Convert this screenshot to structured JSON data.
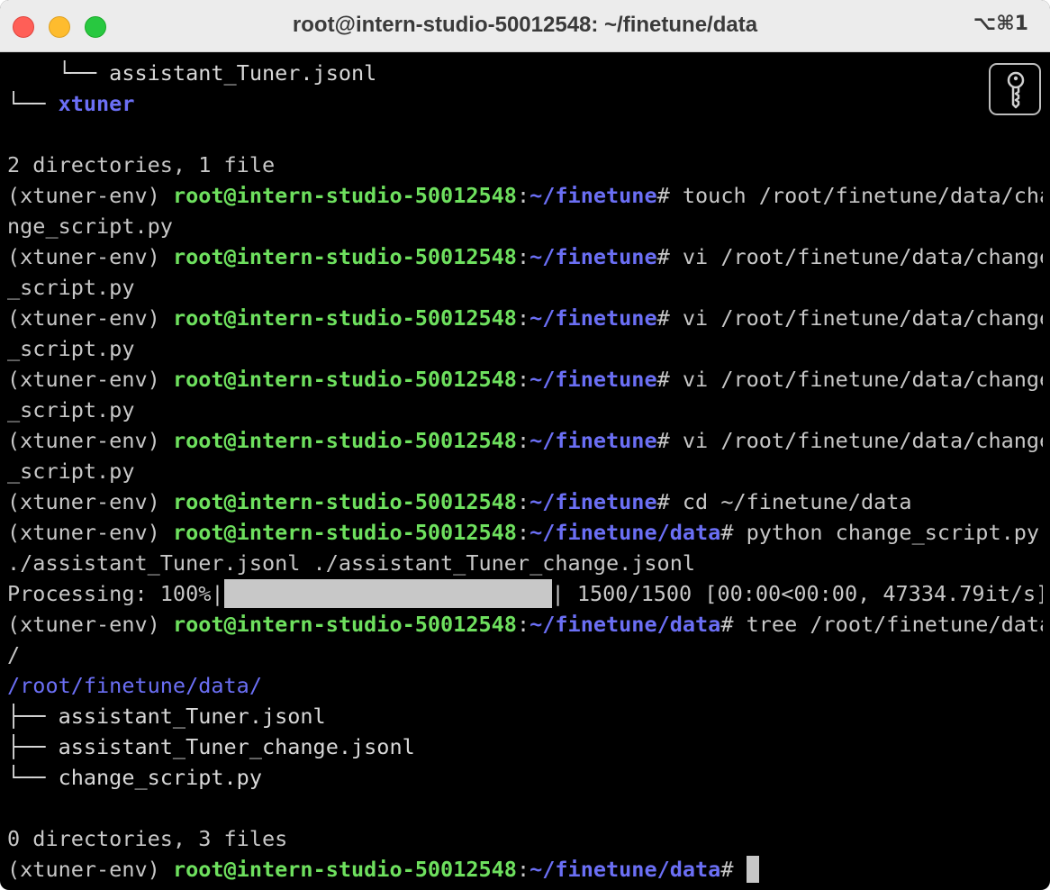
{
  "window": {
    "title": "root@intern-studio-50012548: ~/finetune/data",
    "shortcut": "⌥⌘1"
  },
  "terminal": {
    "env": "(xtuner-env) ",
    "user_host": "root@intern-studio-50012548",
    "colon": ":",
    "path_finetune": "~/finetune",
    "path_data": "~/finetune/data",
    "hash": "# ",
    "tree_top": {
      "file_line": "    └── assistant_Tuner.jsonl",
      "dir_branch": "└── ",
      "dir_name": "xtuner",
      "summary": "2 directories, 1 file"
    },
    "commands": [
      {
        "cmd": "touch /root/finetune/data/cha",
        "wrap": "nge_script.py"
      },
      {
        "cmd": "vi /root/finetune/data/change",
        "wrap": "_script.py"
      },
      {
        "cmd": "vi /root/finetune/data/change",
        "wrap": "_script.py"
      },
      {
        "cmd": "vi /root/finetune/data/change",
        "wrap": "_script.py"
      },
      {
        "cmd": "vi /root/finetune/data/change",
        "wrap": "_script.py"
      },
      {
        "cmd": "cd ~/finetune/data"
      },
      {
        "cmd": "python change_script.py",
        "wrap": "./assistant_Tuner.jsonl ./assistant_Tuner_change.jsonl"
      },
      {
        "cmd": "tree /root/finetune/data",
        "wrap": "/"
      }
    ],
    "progress": {
      "label": "Processing: 100%|",
      "percent": 100,
      "stats": "| 1500/1500 [00:00<00:00, 47334.79it/s]"
    },
    "tree_result": {
      "root": "/root/finetune/data/",
      "entries": [
        {
          "branch": "├── ",
          "name": "assistant_Tuner.jsonl"
        },
        {
          "branch": "├── ",
          "name": "assistant_Tuner_change.jsonl"
        },
        {
          "branch": "└── ",
          "name": "change_script.py"
        }
      ],
      "summary": "0 directories, 3 files"
    },
    "icons": {
      "key_button": "key-icon"
    }
  }
}
